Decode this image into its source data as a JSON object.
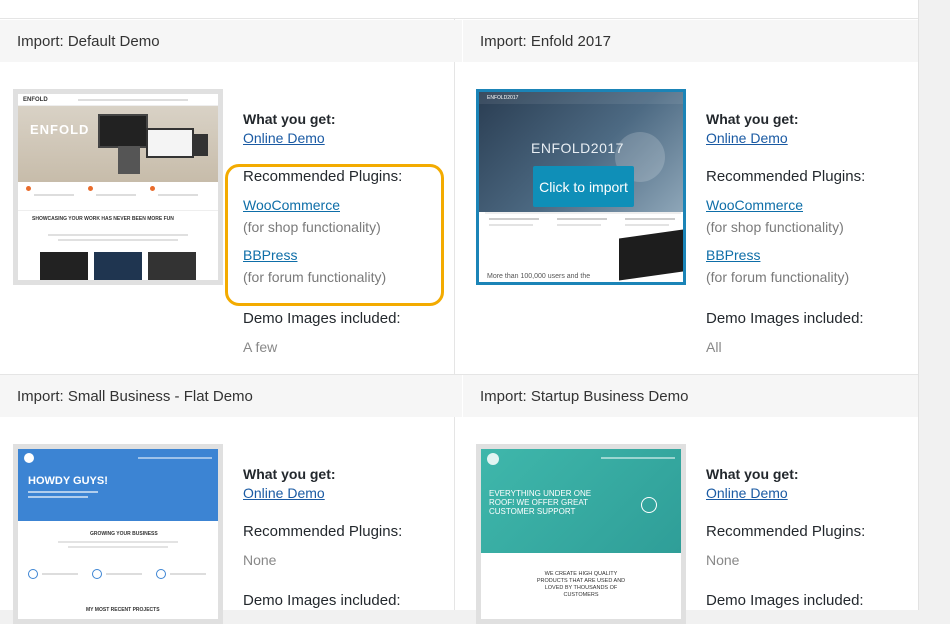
{
  "demos": [
    {
      "title": "Import: Default Demo",
      "what_label": "What you get:",
      "demo_link": "Online Demo",
      "plugins_label": "Recommended Plugins:",
      "plugin1": "WooCommerce",
      "plugin1_note": "(for shop functionality)",
      "plugin2": "BBPress",
      "plugin2_note": "(for forum functionality)",
      "images_label": "Demo Images included:",
      "images_value": "A few",
      "thumb_brand": "ENFOLD",
      "thumb_slogan": "SHOWCASING YOUR WORK HAS NEVER BEEN MORE FUN"
    },
    {
      "title": "Import: Enfold 2017",
      "what_label": "What you get:",
      "demo_link": "Online Demo",
      "plugins_label": "Recommended Plugins:",
      "plugin1": "WooCommerce",
      "plugin1_note": "(for shop functionality)",
      "plugin2": "BBPress",
      "plugin2_note": "(for forum functionality)",
      "images_label": "Demo Images included:",
      "images_value": "All",
      "thumb_brand": "ENFOLD2017",
      "thumb_button": "Click to import",
      "thumb_bottom": "More than 100,000 users and the"
    },
    {
      "title": "Import: Small Business - Flat Demo",
      "what_label": "What you get:",
      "demo_link": "Online Demo",
      "plugins_label": "Recommended Plugins:",
      "plugins_value": "None",
      "images_label": "Demo Images included:",
      "thumb_headline": "HOWDY GUYS!",
      "thumb_section": "GROWING YOUR BUSINESS",
      "thumb_footer": "MY MOST RECENT PROJECTS"
    },
    {
      "title": "Import: Startup Business Demo",
      "what_label": "What you get:",
      "demo_link": "Online Demo",
      "plugins_label": "Recommended Plugins:",
      "plugins_value": "None",
      "images_label": "Demo Images included:",
      "thumb_headline": "EVERYTHING UNDER ONE ROOF! WE OFFER GREAT CUSTOMER SUPPORT",
      "thumb_tagline": "WE CREATE HIGH QUALITY PRODUCTS THAT ARE USED AND LOVED BY THOUSANDS OF CUSTOMERS"
    }
  ]
}
